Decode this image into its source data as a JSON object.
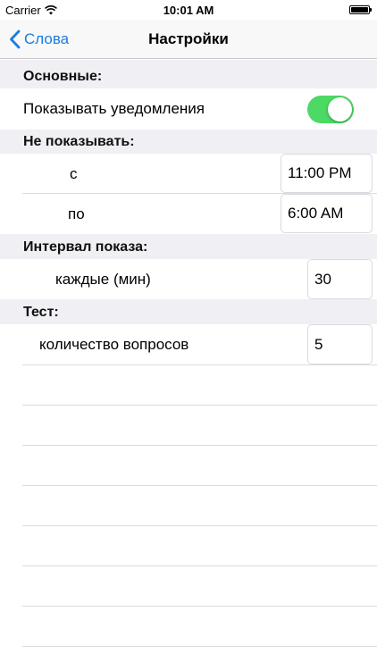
{
  "status_bar": {
    "carrier": "Carrier",
    "time": "10:01 AM"
  },
  "nav": {
    "back_label": "Слова",
    "title": "Настройки"
  },
  "sections": {
    "main": {
      "header": "Основные:",
      "show_notifications_label": "Показывать уведомления",
      "show_notifications_on": true
    },
    "do_not_show": {
      "header": "Не показывать:",
      "from_label": "с",
      "from_value": "11:00 PM",
      "to_label": "по",
      "to_value": "6:00 AM"
    },
    "interval": {
      "header": "Интервал показа:",
      "every_label": "каждые (мин)",
      "every_value": "30"
    },
    "test": {
      "header": "Тест:",
      "questions_label": "количество вопросов",
      "questions_value": "5"
    }
  },
  "colors": {
    "accent": "#1a7de0",
    "toggle_on": "#4cd964",
    "section_bg": "#efeff4"
  }
}
